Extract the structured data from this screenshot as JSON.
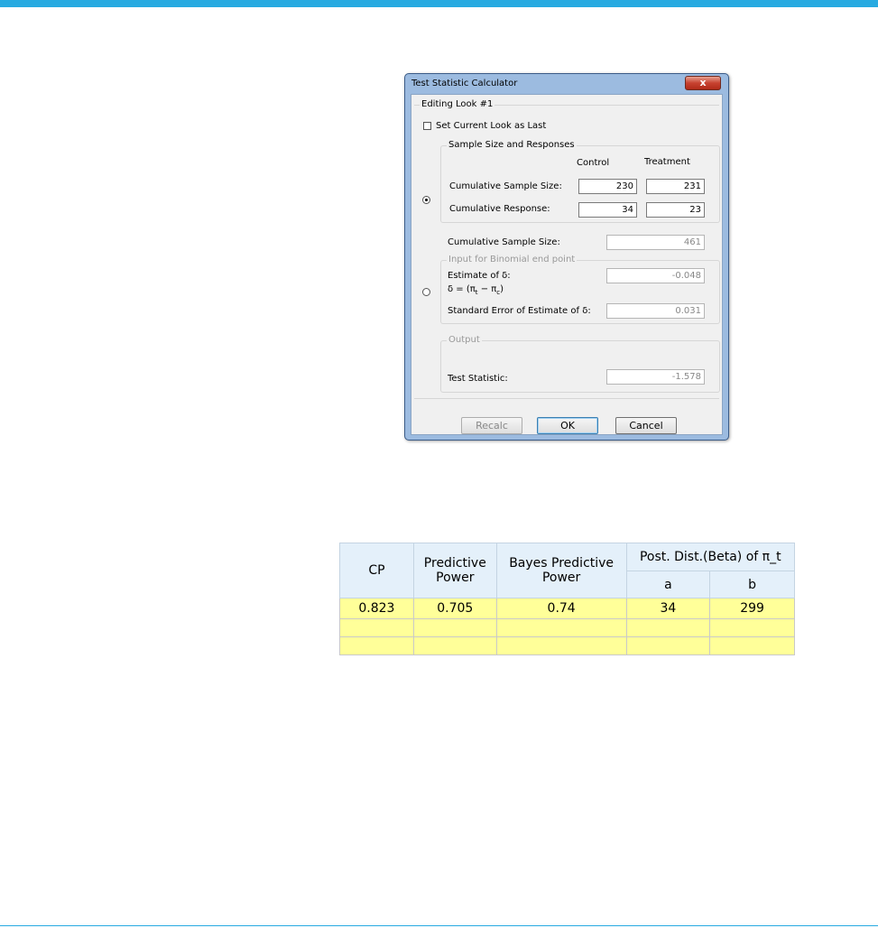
{
  "colors": {
    "accent_bar": "#27aae1",
    "table_header_bg": "#e4f0fa",
    "table_cell_bg": "#ffff99"
  },
  "dialog": {
    "title": "Test Statistic Calculator",
    "close_glyph": "x",
    "editing_group_title": "Editing Look #1",
    "set_last_label": "Set Current Look as Last",
    "set_last_checked": false,
    "sample_group": {
      "title": "Sample Size and Responses",
      "radio_selected": true,
      "col_control": "Control",
      "col_treatment": "Treatment",
      "row1_label": "Cumulative Sample Size:",
      "row1_control": "230",
      "row1_treatment": "231",
      "row2_label": "Cumulative Response:",
      "row2_control": "34",
      "row2_treatment": "23"
    },
    "cum_sample_label": "Cumulative Sample Size:",
    "cum_sample_value": "461",
    "binomial_group": {
      "title": "Input for Binomial end point",
      "radio_selected": false,
      "estimate_label": "Estimate of δ:",
      "estimate_value": "-0.048",
      "delta_def_prefix": "δ = (π",
      "delta_def_sub_t": "t",
      "delta_def_mid": " − π",
      "delta_def_sub_c": "c",
      "delta_def_suffix": ")",
      "se_label": "Standard Error of Estimate of δ:",
      "se_value": "0.031"
    },
    "output_group": {
      "title": "Output",
      "test_stat_label": "Test Statistic:",
      "test_stat_value": "-1.578"
    },
    "buttons": {
      "recalc": "Recalc",
      "ok": "OK",
      "cancel": "Cancel"
    }
  },
  "results_table": {
    "headers": {
      "cp": "CP",
      "predictive_power": "Predictive Power",
      "bayes_predictive_power": "Bayes Predictive Power",
      "post_dist": "Post. Dist.(Beta) of π_t",
      "a": "a",
      "b": "b"
    },
    "rows": [
      [
        "0.823",
        "0.705",
        "0.74",
        "34",
        "299"
      ],
      [
        "",
        "",
        "",
        "",
        ""
      ],
      [
        "",
        "",
        "",
        "",
        ""
      ]
    ]
  }
}
